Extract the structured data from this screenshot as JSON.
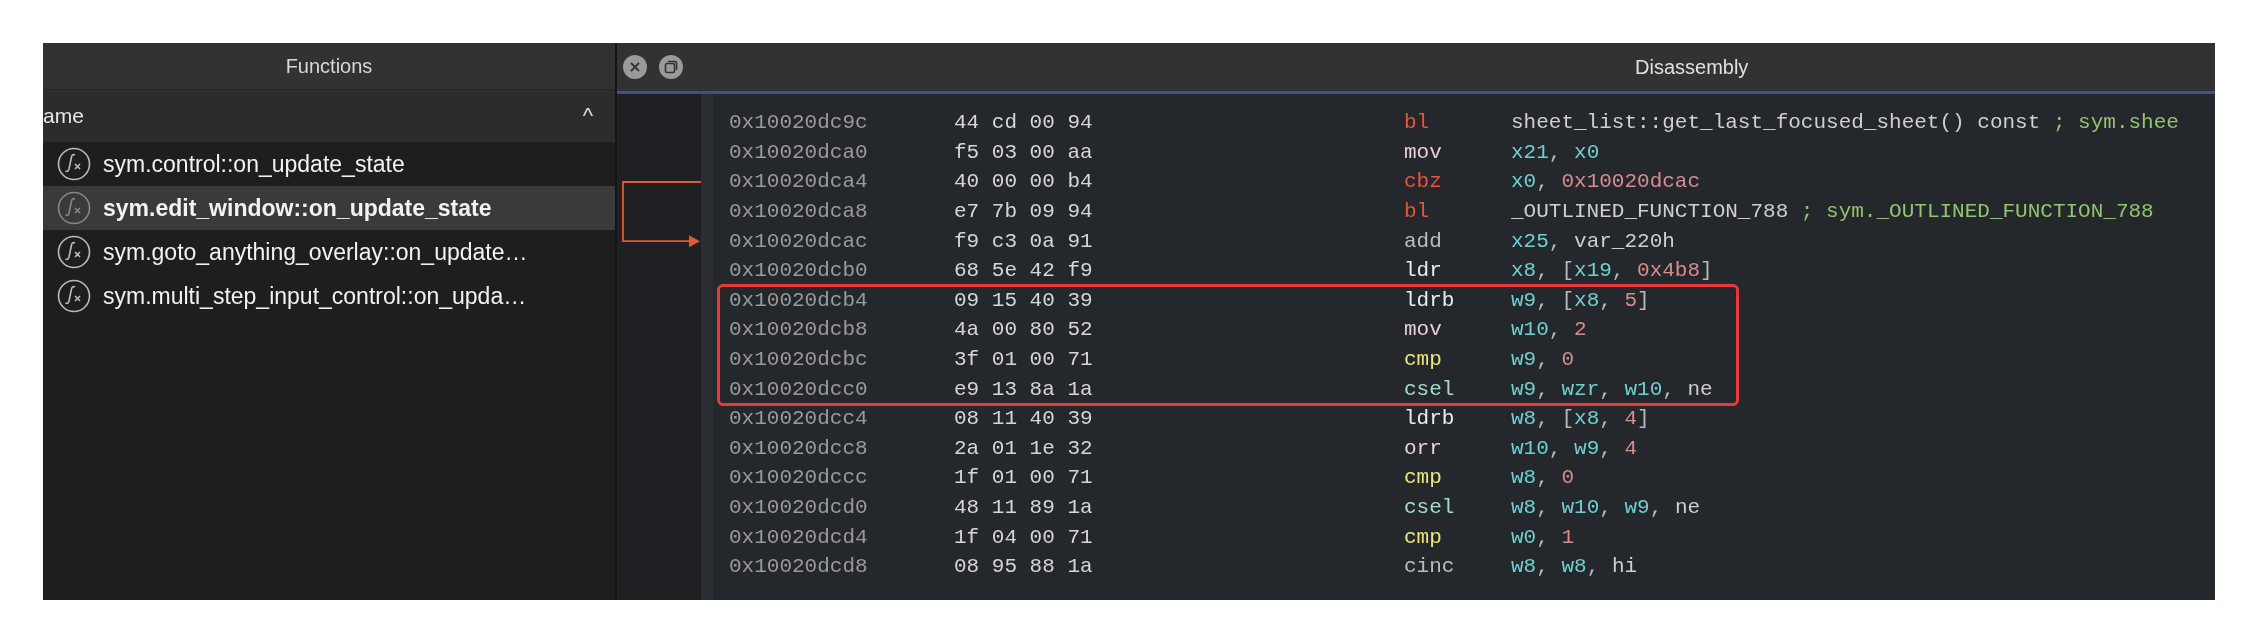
{
  "functions_panel": {
    "title": "Functions",
    "column_header": "ame",
    "sort_indicator": "^",
    "items": [
      {
        "label": "sym.control::on_update_state",
        "selected": false
      },
      {
        "label": "sym.edit_window::on_update_state",
        "selected": true
      },
      {
        "label": "sym.goto_anything_overlay::on_update…",
        "selected": false
      },
      {
        "label": "sym.multi_step_input_control::on_upda…",
        "selected": false
      }
    ]
  },
  "disassembly_panel": {
    "title": "Disassembly",
    "rows": [
      {
        "address": "0x10020dc9c",
        "bytes": "44 cd 00 94",
        "mnemonic": "bl",
        "kind": "call",
        "highlighted": false,
        "operands": [
          {
            "text": "sheet_list::get_last_focused_sheet() const ",
            "kind": "sym"
          },
          {
            "text": "; sym.shee",
            "kind": "comment"
          }
        ]
      },
      {
        "address": "0x10020dca0",
        "bytes": "f5 03 00 aa",
        "mnemonic": "mov",
        "kind": "move",
        "highlighted": false,
        "operands": [
          {
            "text": "x21",
            "kind": "reg"
          },
          {
            "text": ", ",
            "kind": "punct"
          },
          {
            "text": "x0",
            "kind": "reg"
          }
        ]
      },
      {
        "address": "0x10020dca4",
        "bytes": "40 00 00 b4",
        "mnemonic": "cbz",
        "kind": "branch",
        "highlighted": false,
        "branch_from": true,
        "operands": [
          {
            "text": "x0",
            "kind": "reg"
          },
          {
            "text": ", ",
            "kind": "punct"
          },
          {
            "text": "0x10020dcac",
            "kind": "imm"
          }
        ]
      },
      {
        "address": "0x10020dca8",
        "bytes": "e7 7b 09 94",
        "mnemonic": "bl",
        "kind": "call",
        "highlighted": false,
        "operands": [
          {
            "text": "_OUTLINED_FUNCTION_788 ",
            "kind": "sym"
          },
          {
            "text": "; sym._OUTLINED_FUNCTION_788",
            "kind": "comment"
          }
        ]
      },
      {
        "address": "0x10020dcac",
        "bytes": "f9 c3 0a 91",
        "mnemonic": "add",
        "kind": "arith",
        "highlighted": false,
        "branch_to": true,
        "operands": [
          {
            "text": "x25",
            "kind": "reg"
          },
          {
            "text": ", ",
            "kind": "punct"
          },
          {
            "text": "var_220h",
            "kind": "sym"
          }
        ]
      },
      {
        "address": "0x10020dcb0",
        "bytes": "68 5e 42 f9",
        "mnemonic": "ldr",
        "kind": "load",
        "highlighted": false,
        "operands": [
          {
            "text": "x8",
            "kind": "reg"
          },
          {
            "text": ", [",
            "kind": "punct"
          },
          {
            "text": "x19",
            "kind": "reg"
          },
          {
            "text": ", ",
            "kind": "punct"
          },
          {
            "text": "0x4b8",
            "kind": "imm"
          },
          {
            "text": "]",
            "kind": "punct"
          }
        ]
      },
      {
        "address": "0x10020dcb4",
        "bytes": "09 15 40 39",
        "mnemonic": "ldrb",
        "kind": "load",
        "highlighted": true,
        "operands": [
          {
            "text": "w9",
            "kind": "reg"
          },
          {
            "text": ", [",
            "kind": "punct"
          },
          {
            "text": "x8",
            "kind": "reg"
          },
          {
            "text": ", ",
            "kind": "punct"
          },
          {
            "text": "5",
            "kind": "imm"
          },
          {
            "text": "]",
            "kind": "punct"
          }
        ]
      },
      {
        "address": "0x10020dcb8",
        "bytes": "4a 00 80 52",
        "mnemonic": "mov",
        "kind": "move",
        "highlighted": true,
        "operands": [
          {
            "text": "w10",
            "kind": "reg"
          },
          {
            "text": ", ",
            "kind": "punct"
          },
          {
            "text": "2",
            "kind": "imm"
          }
        ]
      },
      {
        "address": "0x10020dcbc",
        "bytes": "3f 01 00 71",
        "mnemonic": "cmp",
        "kind": "compare",
        "highlighted": true,
        "operands": [
          {
            "text": "w9",
            "kind": "reg"
          },
          {
            "text": ", ",
            "kind": "punct"
          },
          {
            "text": "0",
            "kind": "imm"
          }
        ]
      },
      {
        "address": "0x10020dcc0",
        "bytes": "e9 13 8a 1a",
        "mnemonic": "csel",
        "kind": "select",
        "highlighted": true,
        "operands": [
          {
            "text": "w9",
            "kind": "reg"
          },
          {
            "text": ", ",
            "kind": "punct"
          },
          {
            "text": "wzr",
            "kind": "reg"
          },
          {
            "text": ", ",
            "kind": "punct"
          },
          {
            "text": "w10",
            "kind": "reg"
          },
          {
            "text": ", ",
            "kind": "punct"
          },
          {
            "text": "ne",
            "kind": "sym"
          }
        ]
      },
      {
        "address": "0x10020dcc4",
        "bytes": "08 11 40 39",
        "mnemonic": "ldrb",
        "kind": "load",
        "highlighted": false,
        "operands": [
          {
            "text": "w8",
            "kind": "reg"
          },
          {
            "text": ", [",
            "kind": "punct"
          },
          {
            "text": "x8",
            "kind": "reg"
          },
          {
            "text": ", ",
            "kind": "punct"
          },
          {
            "text": "4",
            "kind": "imm"
          },
          {
            "text": "]",
            "kind": "punct"
          }
        ]
      },
      {
        "address": "0x10020dcc8",
        "bytes": "2a 01 1e 32",
        "mnemonic": "orr",
        "kind": "move",
        "highlighted": false,
        "operands": [
          {
            "text": "w10",
            "kind": "reg"
          },
          {
            "text": ", ",
            "kind": "punct"
          },
          {
            "text": "w9",
            "kind": "reg"
          },
          {
            "text": ", ",
            "kind": "punct"
          },
          {
            "text": "4",
            "kind": "imm"
          }
        ]
      },
      {
        "address": "0x10020dccc",
        "bytes": "1f 01 00 71",
        "mnemonic": "cmp",
        "kind": "compare",
        "highlighted": false,
        "operands": [
          {
            "text": "w8",
            "kind": "reg"
          },
          {
            "text": ", ",
            "kind": "punct"
          },
          {
            "text": "0",
            "kind": "imm"
          }
        ]
      },
      {
        "address": "0x10020dcd0",
        "bytes": "48 11 89 1a",
        "mnemonic": "csel",
        "kind": "select",
        "highlighted": false,
        "operands": [
          {
            "text": "w8",
            "kind": "reg"
          },
          {
            "text": ", ",
            "kind": "punct"
          },
          {
            "text": "w10",
            "kind": "reg"
          },
          {
            "text": ", ",
            "kind": "punct"
          },
          {
            "text": "w9",
            "kind": "reg"
          },
          {
            "text": ", ",
            "kind": "punct"
          },
          {
            "text": "ne",
            "kind": "sym"
          }
        ]
      },
      {
        "address": "0x10020dcd4",
        "bytes": "1f 04 00 71",
        "mnemonic": "cmp",
        "kind": "compare",
        "highlighted": false,
        "operands": [
          {
            "text": "w0",
            "kind": "reg"
          },
          {
            "text": ", ",
            "kind": "punct"
          },
          {
            "text": "1",
            "kind": "imm"
          }
        ]
      },
      {
        "address": "0x10020dcd8",
        "bytes": "08 95 88 1a",
        "mnemonic": "cinc",
        "kind": "arith",
        "highlighted": false,
        "operands": [
          {
            "text": "w8",
            "kind": "reg"
          },
          {
            "text": ", ",
            "kind": "punct"
          },
          {
            "text": "w8",
            "kind": "reg"
          },
          {
            "text": ", ",
            "kind": "punct"
          },
          {
            "text": "hi",
            "kind": "sym"
          }
        ]
      }
    ]
  }
}
